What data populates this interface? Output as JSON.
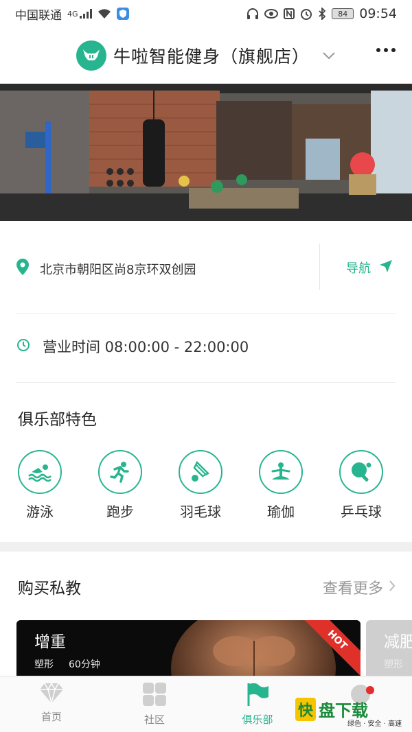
{
  "status_bar": {
    "carrier": "中国联通",
    "network": "4G",
    "battery": "84",
    "time": "09:54"
  },
  "header": {
    "title": "牛啦智能健身（旗舰店）",
    "brand_color": "#27b58f"
  },
  "location": {
    "address": "北京市朝阳区尚8京环双创园",
    "nav_label": "导航"
  },
  "hours": {
    "text": "营业时间 08:00:00 - 22:00:00"
  },
  "features": {
    "title": "俱乐部特色",
    "items": [
      {
        "label": "游泳",
        "icon": "swimming-icon"
      },
      {
        "label": "跑步",
        "icon": "running-icon"
      },
      {
        "label": "羽毛球",
        "icon": "badminton-icon"
      },
      {
        "label": "瑜伽",
        "icon": "yoga-icon"
      },
      {
        "label": "乒乓球",
        "icon": "table-tennis-icon"
      }
    ]
  },
  "trainers": {
    "title": "购买私教",
    "see_more": "查看更多",
    "cards": [
      {
        "title": "增重",
        "category": "塑形",
        "duration": "60分钟",
        "badge": "HOT"
      },
      {
        "title": "减肥",
        "category": "塑形"
      }
    ]
  },
  "tabbar": {
    "items": [
      {
        "label": "首页",
        "icon": "diamond-icon"
      },
      {
        "label": "社区",
        "icon": "grid-icon"
      },
      {
        "label": "俱乐部",
        "icon": "flag-icon"
      }
    ]
  },
  "watermark": {
    "logo_text": "快",
    "text": "盘下载",
    "sub": "绿色 · 安全 · 高速"
  }
}
